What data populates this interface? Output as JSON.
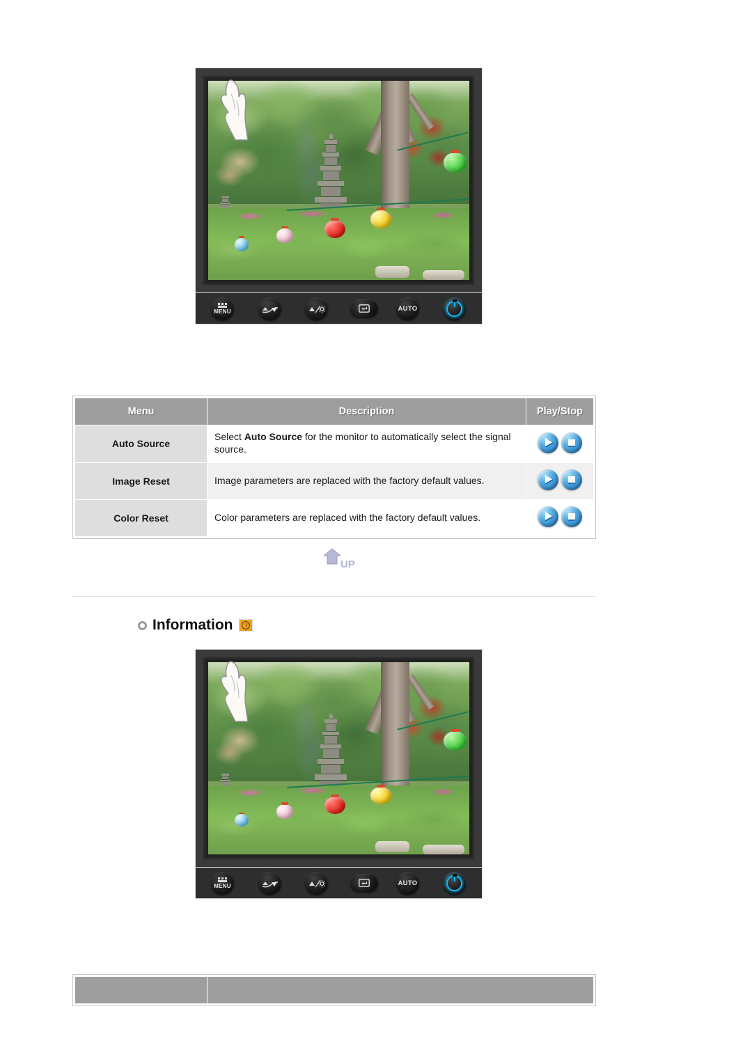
{
  "page": {
    "background": "#ffffff",
    "accent_gray": "#9e9e9e",
    "cell_gray": "#dedede",
    "alt_row": "#f0f0f0"
  },
  "monitor_top": {
    "name": "lcd-monitor-illustration",
    "screen_caption": "Photograph of a Korean garden with a multi-tier stone pagoda, green trees and colorful paper lanterns on a string",
    "buttons": [
      {
        "id": "menu",
        "label": "MENU",
        "icon": "menu-grid-icon"
      },
      {
        "id": "down",
        "label": "",
        "icon": "volume-down-icon"
      },
      {
        "id": "up",
        "label": "",
        "icon": "brightness-up-icon"
      },
      {
        "id": "enter",
        "label": "",
        "icon": "source-enter-icon"
      },
      {
        "id": "auto",
        "label": "AUTO",
        "icon": "auto-adjust-icon"
      },
      {
        "id": "power",
        "label": "",
        "icon": "power-icon"
      }
    ],
    "pointer": "pointing-hand-cursor"
  },
  "table": {
    "headers": [
      "Menu",
      "Description",
      "Play/Stop"
    ],
    "rows": [
      {
        "menu": "Auto Source",
        "description_pre": "Select ",
        "description_bold": "Auto Source",
        "description_post": " for the monitor to automatically select the signal source.",
        "play_label": "play-icon",
        "stop_label": "stop-icon"
      },
      {
        "menu": "Image Reset",
        "description_pre": "Image parameters are replaced with the factory default values.",
        "description_bold": "",
        "description_post": "",
        "play_label": "play-icon",
        "stop_label": "stop-icon"
      },
      {
        "menu": "Color Reset",
        "description_pre": "Color parameters are replaced with the factory default values.",
        "description_bold": "",
        "description_post": "",
        "play_label": "play-icon",
        "stop_label": "stop-icon"
      }
    ]
  },
  "up_button": {
    "label": "UP",
    "color": "#b6b8d8"
  },
  "information_section": {
    "bullet": "ring-bullet-icon",
    "title": "Information",
    "icon": "clock-orange-icon",
    "icon_color": "#f0a01e"
  },
  "monitor_bottom": {
    "name": "lcd-monitor-illustration",
    "screen_caption": "Photograph of a Korean garden with a multi-tier stone pagoda, green trees and colorful paper lanterns on a string",
    "buttons": [
      {
        "id": "menu",
        "label": "MENU",
        "icon": "menu-grid-icon"
      },
      {
        "id": "down",
        "label": "",
        "icon": "volume-down-icon"
      },
      {
        "id": "up",
        "label": "",
        "icon": "brightness-up-icon"
      },
      {
        "id": "enter",
        "label": "",
        "icon": "source-enter-icon"
      },
      {
        "id": "auto",
        "label": "AUTO",
        "icon": "auto-adjust-icon"
      },
      {
        "id": "power",
        "label": "",
        "icon": "power-icon"
      }
    ],
    "pointer": "pointing-hand-cursor"
  },
  "bottom_table": {
    "headers": [
      "",
      ""
    ]
  }
}
